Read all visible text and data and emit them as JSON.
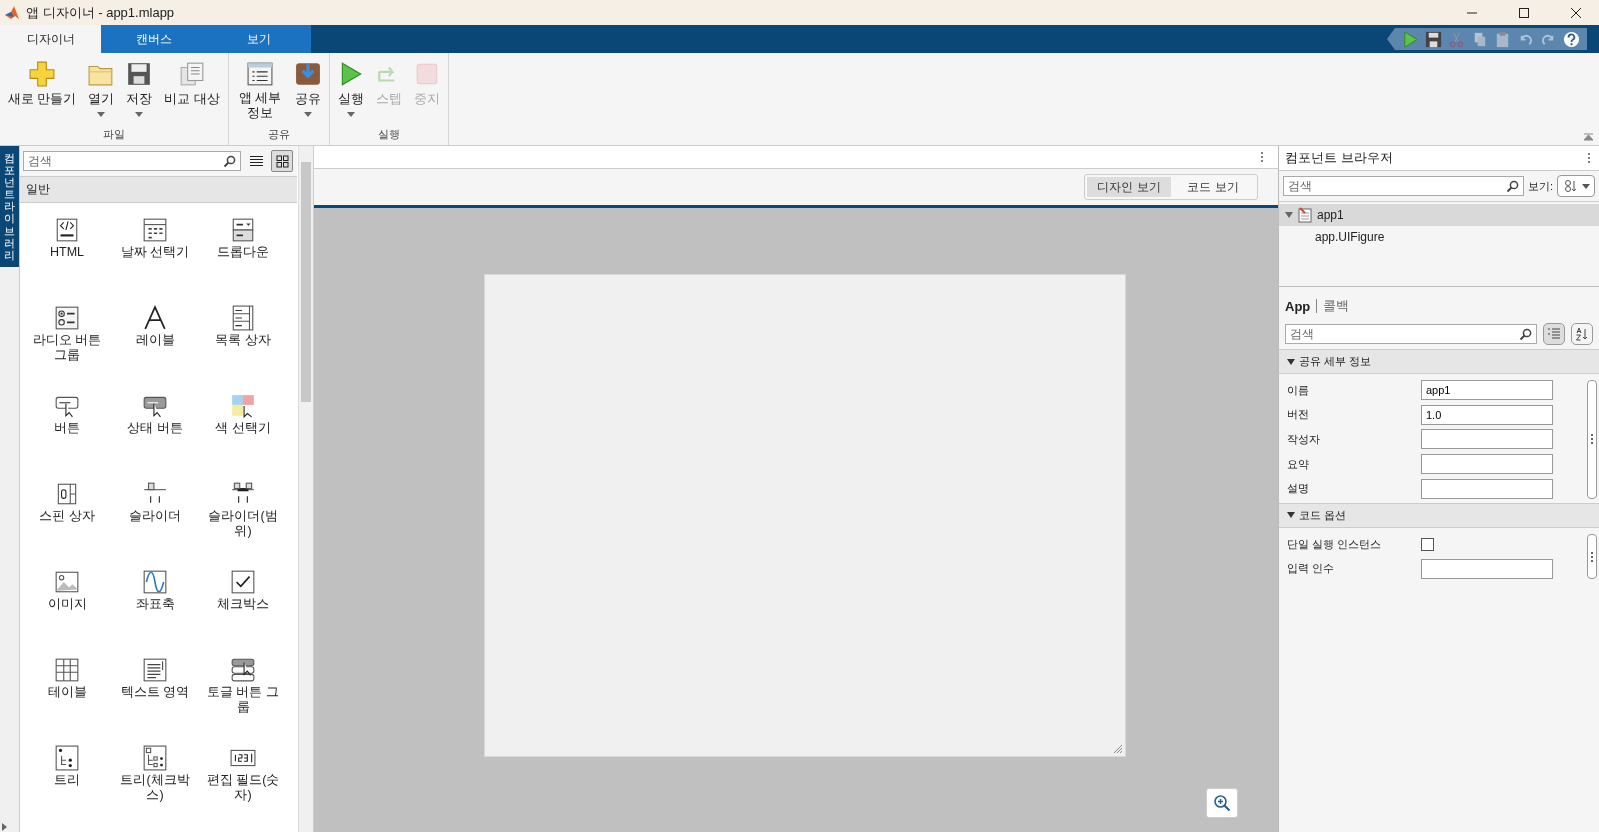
{
  "window": {
    "title": "앱 디자이너 - app1.mlapp"
  },
  "ribbon_tabs": [
    {
      "label": "디자이너",
      "selected": true
    },
    {
      "label": "캔버스",
      "selected": false
    },
    {
      "label": "보기",
      "selected": false
    }
  ],
  "toolbar_groups": [
    {
      "label": "파일",
      "buttons": [
        {
          "label": "새로 만들기",
          "dropdown": false,
          "disabled": false
        },
        {
          "label": "열기",
          "dropdown": true,
          "disabled": false
        },
        {
          "label": "저장",
          "dropdown": true,
          "disabled": false
        },
        {
          "label": "비교 대상",
          "dropdown": false,
          "disabled": false
        }
      ]
    },
    {
      "label": "공유",
      "buttons": [
        {
          "label": "앱 세부 정보",
          "dropdown": false,
          "disabled": false
        },
        {
          "label": "공유",
          "dropdown": true,
          "disabled": false
        }
      ]
    },
    {
      "label": "실행",
      "buttons": [
        {
          "label": "실행",
          "dropdown": true,
          "disabled": false
        },
        {
          "label": "스텝",
          "dropdown": false,
          "disabled": true
        },
        {
          "label": "중지",
          "dropdown": false,
          "disabled": true
        }
      ]
    }
  ],
  "library": {
    "side_tab": "컴포넌트 라이브러리",
    "search_placeholder": "검색",
    "view_modes": [
      {
        "selected": false
      },
      {
        "selected": true
      }
    ],
    "section": "일반",
    "items": [
      {
        "label": "HTML"
      },
      {
        "label": "날짜 선택기"
      },
      {
        "label": "드롭다운"
      },
      {
        "label": "라디오 버튼 그룹"
      },
      {
        "label": "레이블"
      },
      {
        "label": "목록 상자"
      },
      {
        "label": "버튼"
      },
      {
        "label": "상태 버튼"
      },
      {
        "label": "색 선택기"
      },
      {
        "label": "스핀 상자"
      },
      {
        "label": "슬라이더"
      },
      {
        "label": "슬라이더(범위)"
      },
      {
        "label": "이미지"
      },
      {
        "label": "좌표축"
      },
      {
        "label": "체크박스"
      },
      {
        "label": "테이블"
      },
      {
        "label": "텍스트 영역"
      },
      {
        "label": "토글 버튼 그룹"
      },
      {
        "label": "트리"
      },
      {
        "label": "트리(체크박스)"
      },
      {
        "label": "편집 필드(숫자)"
      }
    ]
  },
  "canvas": {
    "view_switch": [
      {
        "label": "디자인 보기",
        "selected": true
      },
      {
        "label": "코드 보기",
        "selected": false
      }
    ]
  },
  "component_browser": {
    "title": "컴포넌트 브라우저",
    "search_placeholder": "검색",
    "view_label": "보기:",
    "tree": [
      {
        "label": "app1",
        "expanded": true,
        "selected": true,
        "children": [
          {
            "label": "app.UIFigure",
            "selected": false
          }
        ]
      }
    ]
  },
  "inspector": {
    "tabs": [
      {
        "label": "App",
        "selected": true
      },
      {
        "label": "콜백",
        "selected": false
      }
    ],
    "search_placeholder": "검색",
    "sections": [
      {
        "title": "공유 세부 정보",
        "expanded": true,
        "rows": [
          {
            "label": "이름",
            "kind": "text",
            "value": "app1"
          },
          {
            "label": "버전",
            "kind": "text",
            "value": "1.0"
          },
          {
            "label": "작성자",
            "kind": "text"
          },
          {
            "label": "요약",
            "kind": "text"
          },
          {
            "label": "설명",
            "kind": "text"
          }
        ]
      },
      {
        "title": "코드 옵션",
        "expanded": true,
        "rows": [
          {
            "label": "단일 실행 인스턴스",
            "kind": "checkbox",
            "checked": false
          },
          {
            "label": "입력 인수",
            "kind": "text"
          }
        ]
      }
    ]
  }
}
